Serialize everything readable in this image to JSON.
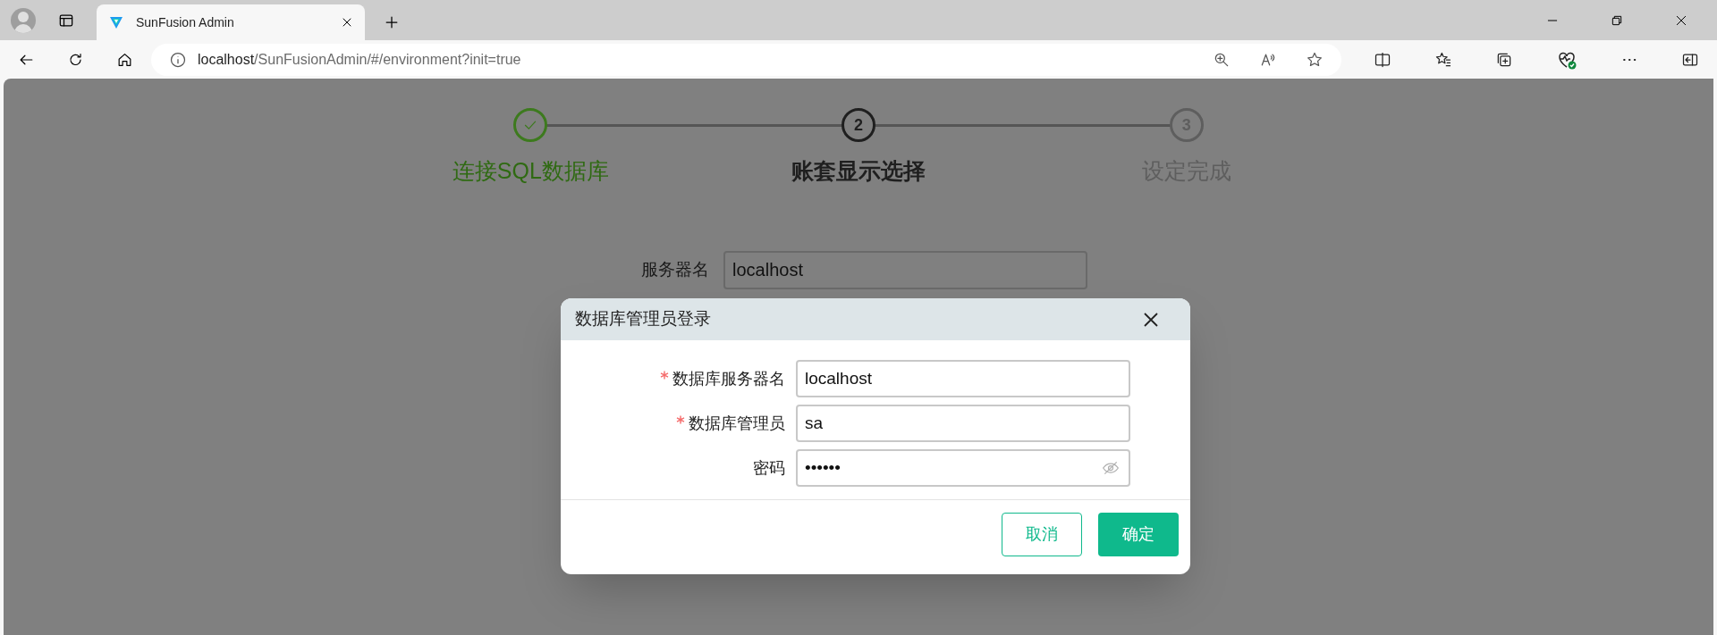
{
  "browser": {
    "tab_title": "SunFusion Admin",
    "address": {
      "host": "localhost",
      "path": "/SunFusionAdmin/#/environment?init=true"
    }
  },
  "steps": [
    {
      "label": "连接SQL数据库",
      "completed": true,
      "active": false
    },
    {
      "number": "2",
      "label": "账套显示选择",
      "completed": false,
      "active": true
    },
    {
      "number": "3",
      "label": "设定完成",
      "completed": false,
      "active": false
    }
  ],
  "background_form": {
    "label": "服务器名",
    "value": "localhost"
  },
  "dialog": {
    "title": "数据库管理员登录",
    "fields": [
      {
        "label": "数据库服务器名",
        "required": true,
        "value": "localhost",
        "kind": "text"
      },
      {
        "label": "数据库管理员",
        "required": true,
        "value": "sa",
        "kind": "text"
      },
      {
        "label": "密码",
        "required": false,
        "value": "••••••",
        "kind": "password"
      }
    ],
    "buttons": [
      {
        "label": "取消",
        "kind": "secondary"
      },
      {
        "label": "确定",
        "kind": "primary"
      }
    ]
  }
}
